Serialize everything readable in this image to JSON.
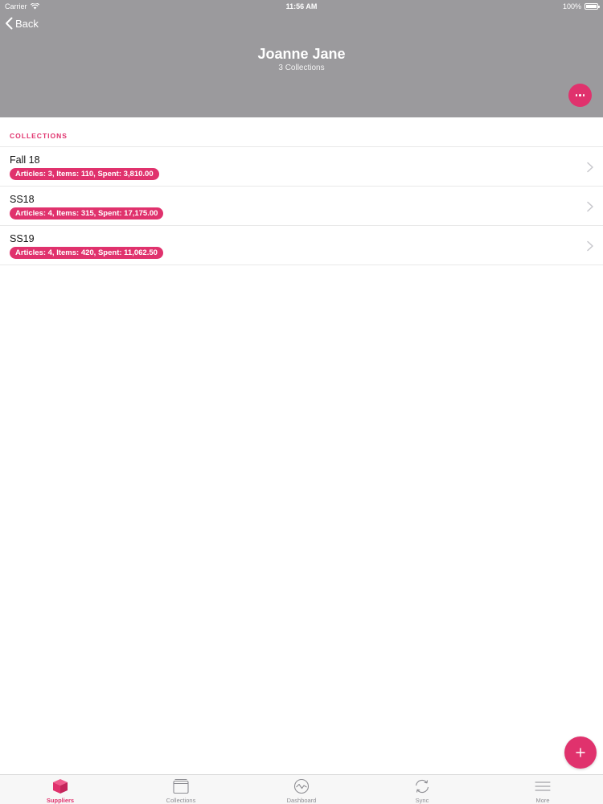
{
  "status_bar": {
    "carrier": "Carrier",
    "time": "11:56 AM",
    "battery": "100%",
    "battery_level": 1.0
  },
  "header": {
    "back_label": "Back",
    "title": "Joanne Jane",
    "subtitle": "3 Collections",
    "more_icon": "ellipsis-icon",
    "background_color": "#9b9a9d"
  },
  "section": {
    "title": "COLLECTIONS"
  },
  "collections": [
    {
      "name": "Fall 18",
      "summary": "Articles: 3, Items: 110, Spent: 3,810.00"
    },
    {
      "name": "SS18",
      "summary": "Articles: 4, Items: 315, Spent: 17,175.00"
    },
    {
      "name": "SS19",
      "summary": "Articles: 4, Items: 420, Spent: 11,062.50"
    }
  ],
  "fab": {
    "icon": "plus-icon"
  },
  "tabs": [
    {
      "label": "Suppliers",
      "icon": "cube-icon",
      "active": true
    },
    {
      "label": "Collections",
      "icon": "folder-icon",
      "active": false
    },
    {
      "label": "Dashboard",
      "icon": "chart-circle-icon",
      "active": false
    },
    {
      "label": "Sync",
      "icon": "sync-icon",
      "active": false
    },
    {
      "label": "More",
      "icon": "menu-icon",
      "active": false
    }
  ],
  "colors": {
    "accent": "#e0326d",
    "inactive": "#8e8e93"
  }
}
